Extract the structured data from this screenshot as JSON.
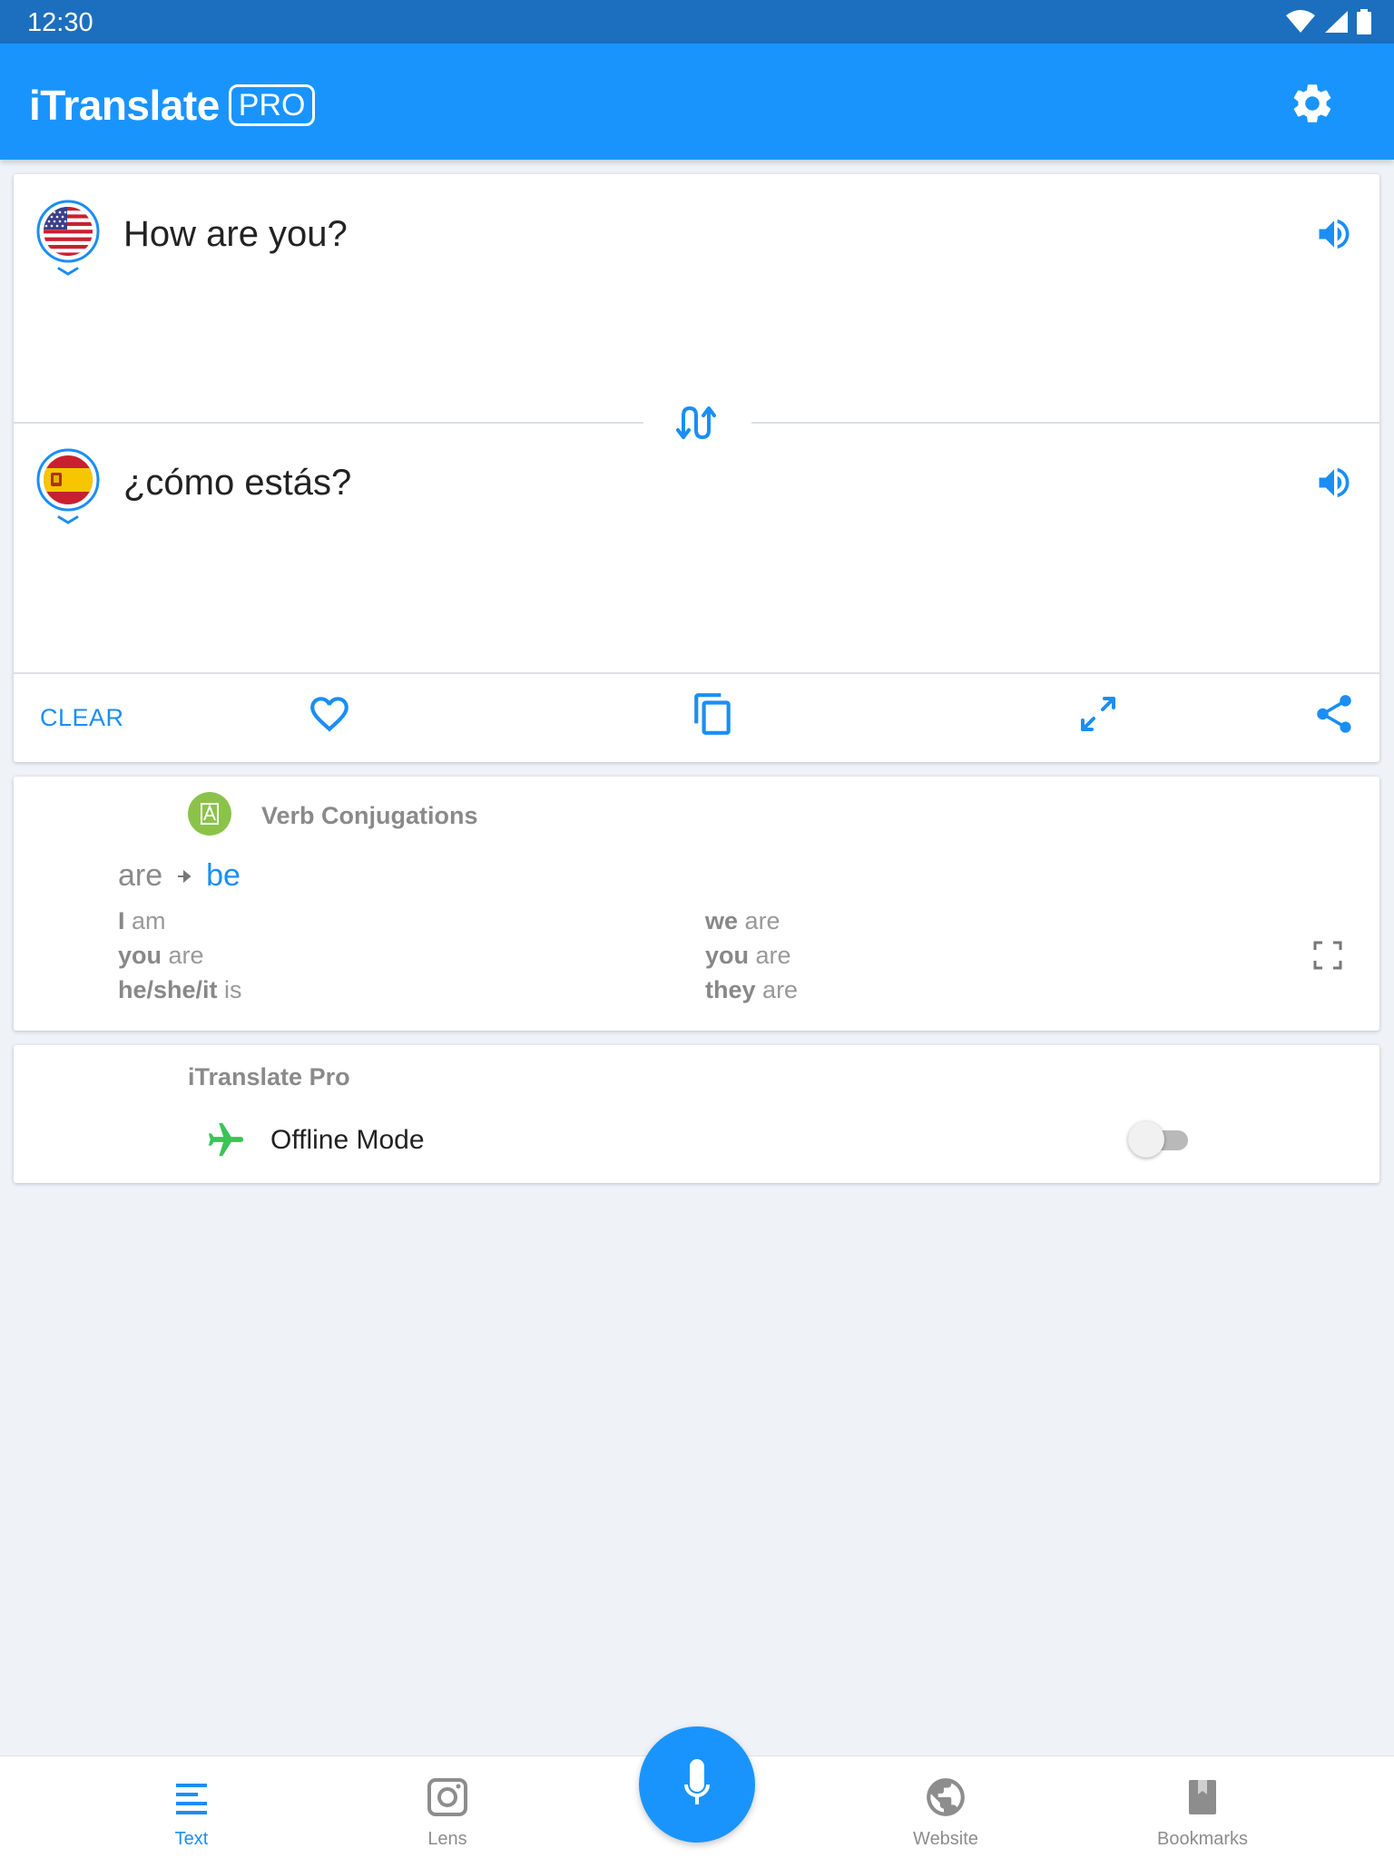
{
  "status_bar": {
    "time": "12:30"
  },
  "app_bar": {
    "title": "iTranslate",
    "badge": "PRO"
  },
  "translation": {
    "source": {
      "flag": "us-flag-icon",
      "text": "How are you?"
    },
    "target": {
      "flag": "spain-flag-icon",
      "text": "¿cómo estás?"
    },
    "actions": {
      "clear_label": "CLEAR"
    }
  },
  "verb_conjugations": {
    "title": "Verb Conjugations",
    "word": "are",
    "infinitive": "be",
    "left": [
      {
        "pronoun": "I",
        "verb": "am"
      },
      {
        "pronoun": "you",
        "verb": "are"
      },
      {
        "pronoun": "he/she/it",
        "verb": "is"
      }
    ],
    "right": [
      {
        "pronoun": "we",
        "verb": "are"
      },
      {
        "pronoun": "you",
        "verb": "are"
      },
      {
        "pronoun": "they",
        "verb": "are"
      }
    ]
  },
  "pro_section": {
    "title": "iTranslate Pro",
    "offline_label": "Offline Mode",
    "offline_enabled": false
  },
  "bottom_nav": {
    "items": [
      {
        "label": "Text",
        "icon": "text-lines-icon",
        "active": true
      },
      {
        "label": "Lens",
        "icon": "camera-icon",
        "active": false
      },
      {
        "label": "Website",
        "icon": "globe-icon",
        "active": false
      },
      {
        "label": "Bookmarks",
        "icon": "bookmark-icon",
        "active": false
      }
    ]
  },
  "colors": {
    "primary": "#1a94fd",
    "status_bar": "#1c6fbe",
    "accent_text": "#1a8ef5",
    "verb_badge": "#8bc34a",
    "plane": "#3ac456"
  }
}
